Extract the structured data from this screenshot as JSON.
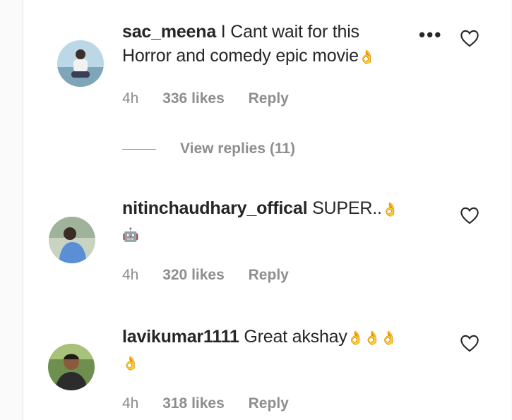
{
  "comments": [
    {
      "username": "sac_meena",
      "text_line1": "I Cant wait for this",
      "text_line2": "Horror and comedy epic movie",
      "emoji_line2": "👌",
      "time": "4h",
      "likes": "336 likes",
      "reply": "Reply",
      "view_replies": "View replies (11)"
    },
    {
      "username": "nitinchaudhary_offical",
      "text_line1": "SUPER..",
      "emoji_line1": "👌",
      "emoji_line2": "🤖",
      "time": "4h",
      "likes": "320 likes",
      "reply": "Reply"
    },
    {
      "username": "lavikumar1111",
      "text_line1": "Great akshay",
      "emoji_line1": "👌👌👌",
      "emoji_line2": "👌",
      "time": "4h",
      "likes": "318 likes",
      "reply": "Reply"
    }
  ],
  "icons": {
    "more": "more-options-icon",
    "like": "heart-outline-icon"
  },
  "colors": {
    "text": "#262626",
    "secondary": "#8e8e8e",
    "background": "#ffffff"
  }
}
